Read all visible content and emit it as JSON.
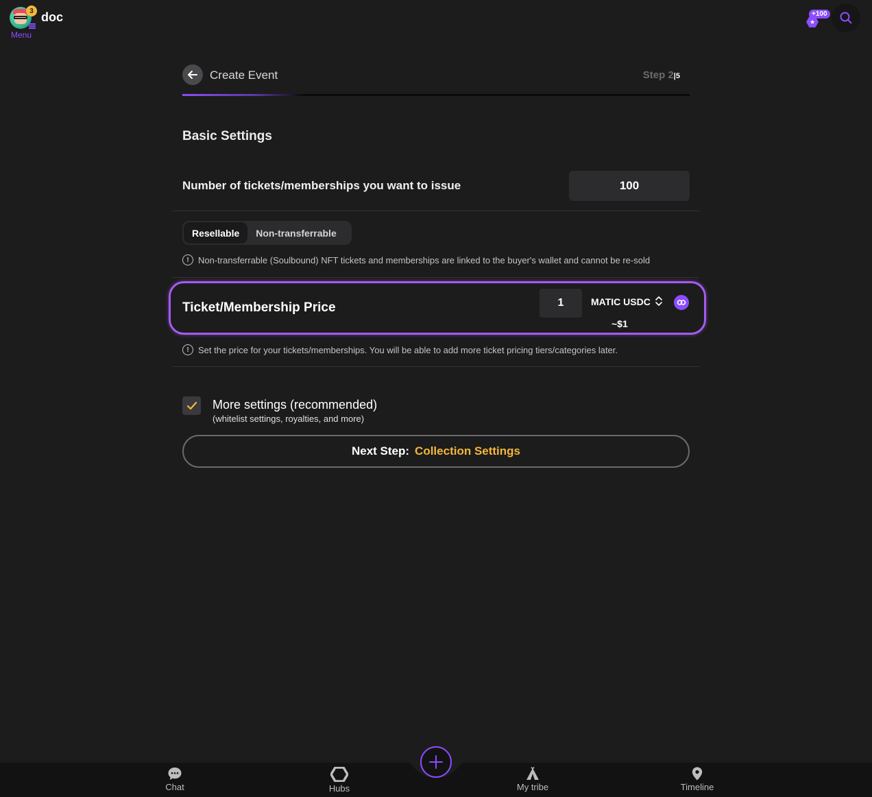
{
  "topbar": {
    "username": "doc",
    "menu_label": "Menu",
    "notification_count": "3",
    "points_badge": "+100"
  },
  "header": {
    "title": "Create Event",
    "step_label": "Step 2",
    "step_total": "5",
    "progress_fraction": 0.24
  },
  "basic_settings": {
    "title": "Basic Settings",
    "tickets_label": "Number of tickets/memberships you want to issue",
    "tickets_value": "100"
  },
  "transfer_toggle": {
    "options": [
      "Resellable",
      "Non-transferrable"
    ],
    "selected": "Resellable",
    "info": "Non-transferrable (Soulbound) NFT tickets and memberships are linked to the buyer's wallet and cannot be re-sold"
  },
  "price": {
    "label": "Ticket/Membership Price",
    "value": "1",
    "currency": "MATIC USDC",
    "approx_usd": "~$1",
    "info": "Set the price for your tickets/memberships. You will be able to add more ticket pricing tiers/categories later."
  },
  "more_settings": {
    "checked": true,
    "title": "More settings (recommended)",
    "subtitle": "(whitelist settings, royalties, and more)"
  },
  "next_button": {
    "prefix": "Next Step:",
    "target": "Collection Settings"
  },
  "bottom_nav": {
    "chat": "Chat",
    "hubs": "Hubs",
    "tribe": "My tribe",
    "timeline": "Timeline"
  },
  "colors": {
    "accent": "#8b4dff",
    "highlight_border": "#a55bf0",
    "gold": "#f5b63a",
    "background": "#1c1c1d"
  }
}
